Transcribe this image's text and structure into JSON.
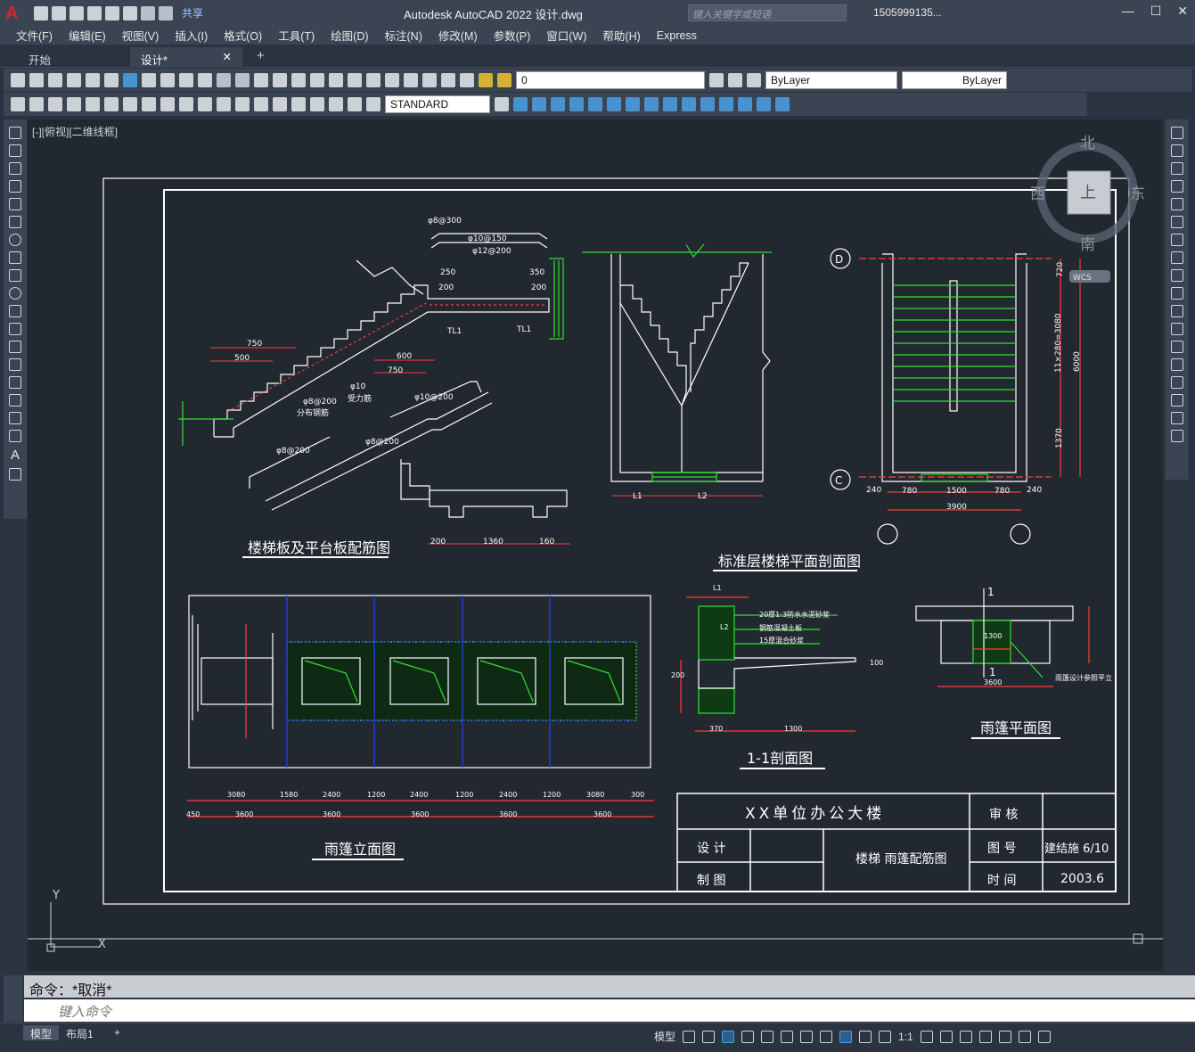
{
  "app": {
    "title": "Autodesk AutoCAD 2022    设计.dwg",
    "logo": "A",
    "share_label": "共享",
    "search_placeholder": "键入关键字或短语",
    "user": "1505999135...",
    "window_controls": [
      "—",
      "☐",
      "✕"
    ]
  },
  "menu": [
    "文件(F)",
    "编辑(E)",
    "视图(V)",
    "插入(I)",
    "格式(O)",
    "工具(T)",
    "绘图(D)",
    "标注(N)",
    "修改(M)",
    "参数(P)",
    "窗口(W)",
    "帮助(H)",
    "Express"
  ],
  "tabs": [
    {
      "label": "开始",
      "active": false
    },
    {
      "label": "设计*",
      "active": true
    }
  ],
  "toolbar": {
    "layer_value": "0",
    "color_value": "ByLayer",
    "linetype_value": "ByLayer",
    "text_style": "STANDARD"
  },
  "viewport": {
    "label": "[-][俯视][二维线框]",
    "viewcube": {
      "north": "北",
      "south": "南",
      "east": "东",
      "west": "西",
      "top": "上",
      "wcs": "WCS"
    },
    "ucs_y": "Y",
    "ucs_x": "X"
  },
  "drawing": {
    "title_stair_slab": "楼梯板及平台板配筋图",
    "title_stair_section": "标准层楼梯平面剖面图",
    "title_canopy_elev": "雨篷立面图",
    "title_section_11": "1-1剖面图",
    "title_canopy_plan": "雨篷平面图",
    "stair_dims": [
      "750",
      "500",
      "600",
      "750",
      "250",
      "200",
      "350",
      "200"
    ],
    "stair_labels": [
      "φ8@200",
      "φ10",
      "受力筋",
      "分布钢筋",
      "TL1",
      "TL1"
    ],
    "stair_rebar_tags": [
      "φ8@300",
      "φ10@150",
      "φ12@200",
      "φ8@200",
      "φ8@200",
      "φ10@200"
    ],
    "platform_dims": [
      "200",
      "1360",
      "160"
    ],
    "section_dims": [
      "L1",
      "L2",
      "370",
      "1300",
      "200",
      "100"
    ],
    "plan_axis_d": "D",
    "plan_axis_c": "C",
    "plan_dims_bottom": [
      "240",
      "780",
      "1500",
      "780",
      "240"
    ],
    "plan_total": "3900",
    "plan_dims_side": [
      "720",
      "11×280=3080",
      "1370",
      "6000"
    ],
    "elev_dims_top": [
      "3080",
      "1580",
      "2400",
      "1200",
      "2400",
      "1200",
      "2400",
      "1200",
      "3080",
      "300"
    ],
    "elev_dims_bottom": [
      "450",
      "3600",
      "3600",
      "3600",
      "3600",
      "3600"
    ],
    "section_notes": [
      "20厚1:3防水水泥砂浆",
      "钢筋混凝土板",
      "15厚混合砂浆"
    ],
    "canopy_plan_labels": [
      "1",
      "1",
      "1300",
      "3600",
      "雨篷设计参照平立"
    ],
    "title_block": {
      "project": "XX单位办公大楼",
      "review": "审 核",
      "design": "设 计",
      "draw": "制 图",
      "drawing_name": "楼梯 雨篷配筋图",
      "sheet_label": "图 号",
      "sheet_value": "建结施 6/10",
      "date_label": "时 间",
      "date_value": "2003.6"
    }
  },
  "command": {
    "history": "命令：*取消*",
    "placeholder": "键入命令"
  },
  "status": {
    "layout_tabs": [
      "模型",
      "布局1"
    ],
    "model_label": "模型",
    "scale": "1:1"
  },
  "colors": {
    "bg": "#212830",
    "drawing_white": "#ffffff",
    "dim_red": "#ff3a3a",
    "green": "#2fe02f",
    "blue": "#2040ff",
    "accent": "#4aa0e6"
  }
}
